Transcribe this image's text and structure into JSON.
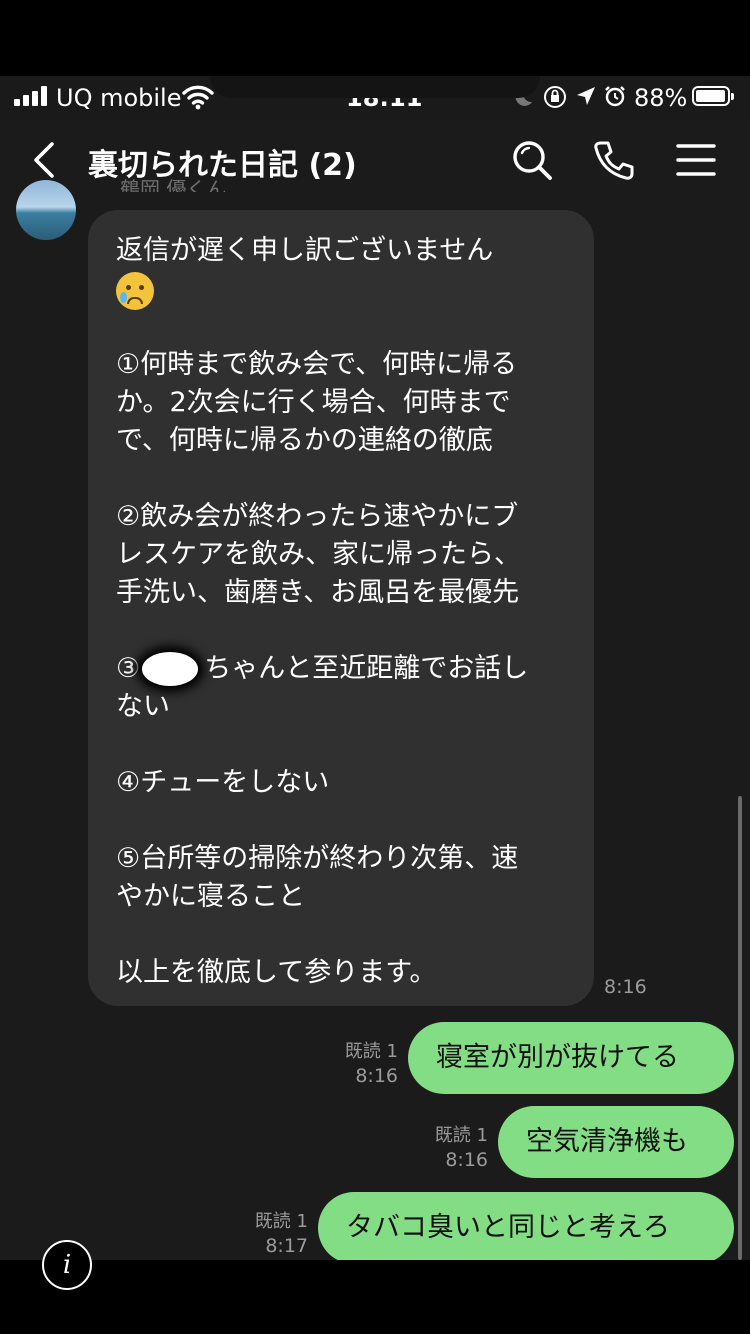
{
  "status_bar": {
    "carrier": "UQ mobile",
    "time": "18:11",
    "battery": "88%"
  },
  "header": {
    "title": "裏切られた日記 (2)",
    "icons": [
      "back-chevron-icon",
      "search-icon",
      "phone-icon",
      "menu-icon"
    ]
  },
  "incoming": {
    "sender": "鶴岡 優くん",
    "time": "8:16",
    "lines": [
      "返信が遅く申し訳ございません",
      "",
      "",
      "①何時まで飲み会で、何時に帰る",
      "か。2次会に行く場合、何時まで",
      "で、何時に帰るかの連絡の徹底",
      "",
      "②飲み会が終わったら速やかにブ",
      "レスケアを飲み、家に帰ったら、",
      "手洗い、歯磨き、お風呂を最優先",
      "",
      "③",
      "ちゃんと至近距離でお話し",
      "ない",
      "",
      "④チューをしない",
      "",
      "⑤台所等の掃除が終わり次第、速",
      "やかに寝ること",
      "",
      "以上を徹底して参ります。"
    ]
  },
  "outgoing": [
    {
      "text": "寝室が別が抜けてる",
      "read": "既読 1",
      "time": "8:16"
    },
    {
      "text": "空気清浄機も",
      "read": "既読 1",
      "time": "8:16"
    },
    {
      "text": "タバコ臭いと同じと考えろ",
      "read": "既読 1",
      "time": "8:17"
    }
  ],
  "info_button": "i",
  "colors": {
    "chat_bg": "#1b1b1b",
    "incoming_bubble": "#303030",
    "outgoing_bubble": "#83dd85"
  }
}
